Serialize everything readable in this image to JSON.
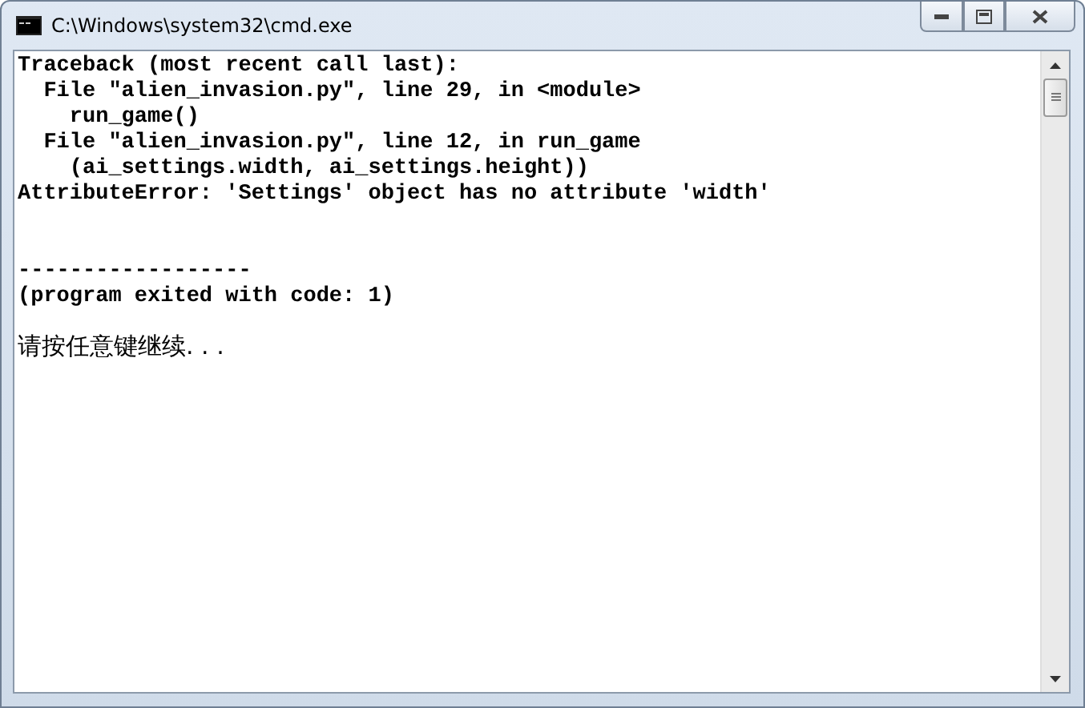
{
  "window": {
    "title": "C:\\Windows\\system32\\cmd.exe"
  },
  "sections": [
    {
      "kind": "traceback",
      "lines": [
        "Traceback (most recent call last):",
        "  File \"alien_invasion.py\", line 29, in <module>",
        "    run_game()",
        "  File \"alien_invasion.py\", line 12, in run_game",
        "    (ai_settings.width, ai_settings.height))",
        "AttributeError: 'Settings' object has no attribute 'width'"
      ]
    },
    {
      "kind": "exit",
      "lines": [
        "------------------",
        "(program exited with code: 1)"
      ]
    },
    {
      "kind": "prompt",
      "lines": [
        "请按任意键继续. . ."
      ]
    }
  ]
}
